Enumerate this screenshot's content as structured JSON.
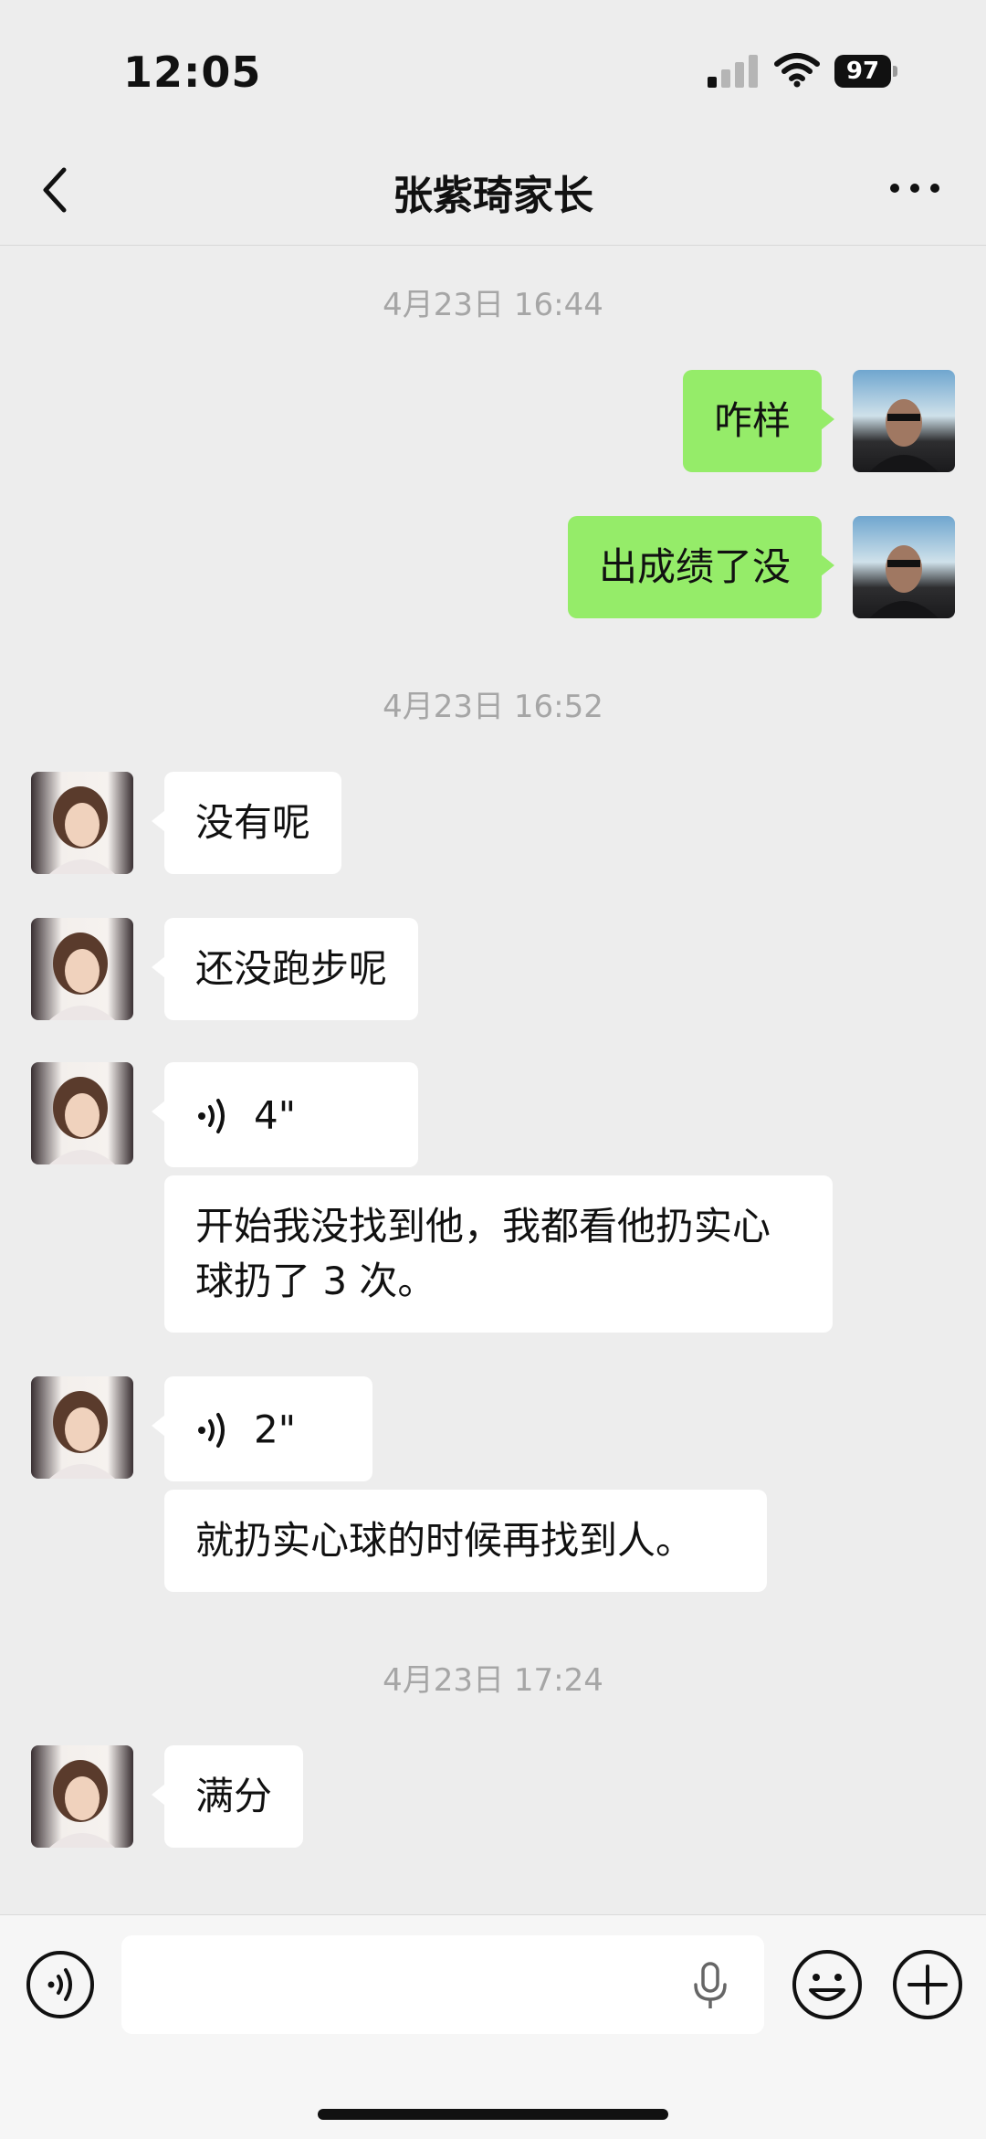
{
  "status_bar": {
    "time": "12:05",
    "battery": "97"
  },
  "nav": {
    "title": "张紫琦家长"
  },
  "chat": {
    "timestamps": [
      "4月23日 16:44",
      "4月23日 16:52",
      "4月23日 17:24"
    ],
    "messages": [
      {
        "sender": "me",
        "text": "咋样"
      },
      {
        "sender": "me",
        "text": "出成绩了没"
      },
      {
        "sender": "contact",
        "text": "没有呢"
      },
      {
        "sender": "contact",
        "text": "还没跑步呢"
      },
      {
        "sender": "contact",
        "type": "voice",
        "text": "4\""
      },
      {
        "sender": "contact",
        "text": "开始我没找到他，我都看他扔实心球扔了 3 次。"
      },
      {
        "sender": "contact",
        "type": "voice",
        "text": "2\""
      },
      {
        "sender": "contact",
        "text": "就扔实心球的时候再找到人。"
      },
      {
        "sender": "contact",
        "text": "满分"
      }
    ]
  },
  "colors": {
    "outgoing_bubble": "#95ec69",
    "incoming_bubble": "#ffffff",
    "background": "#ededed"
  },
  "icons": [
    "back-icon",
    "more-icon",
    "voice-message-icon",
    "voice-toggle-icon",
    "mic-icon",
    "emoji-icon",
    "plus-icon"
  ]
}
